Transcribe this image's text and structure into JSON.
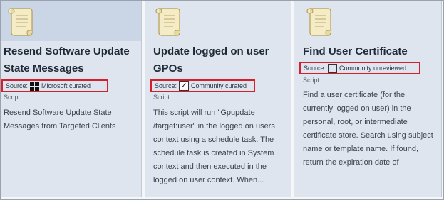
{
  "cards": [
    {
      "title": "Resend Software Update State Messages",
      "source_prefix": "Source:",
      "source_value": "Microsoft curated",
      "source_icon": "microsoft-logo-icon",
      "type": "Script",
      "description": "Resend Software Update State Messages from Targeted Clients"
    },
    {
      "title": "Update logged on user GPOs",
      "source_prefix": "Source:",
      "source_value": "Community curated",
      "source_icon": "checkmark-box-icon",
      "type": "Script",
      "description": "This script will run \"Gpupdate /target:user\" in the logged on users context using a schedule task. The schedule task is created in System context and then executed in the logged on user context. When..."
    },
    {
      "title": "Find User Certificate",
      "source_prefix": "Source:",
      "source_value": "Community unreviewed",
      "source_icon": "empty-box-icon",
      "type": "Script",
      "description": "Find a user certificate (for the currently logged on user) in the personal, root, or intermediate certificate store. Search using subject name or template name. If found, return the expiration date of"
    }
  ],
  "colors": {
    "card_background": "#dfe5ee",
    "selected_header": "#cad6e6",
    "highlight_border": "#d4202d"
  }
}
